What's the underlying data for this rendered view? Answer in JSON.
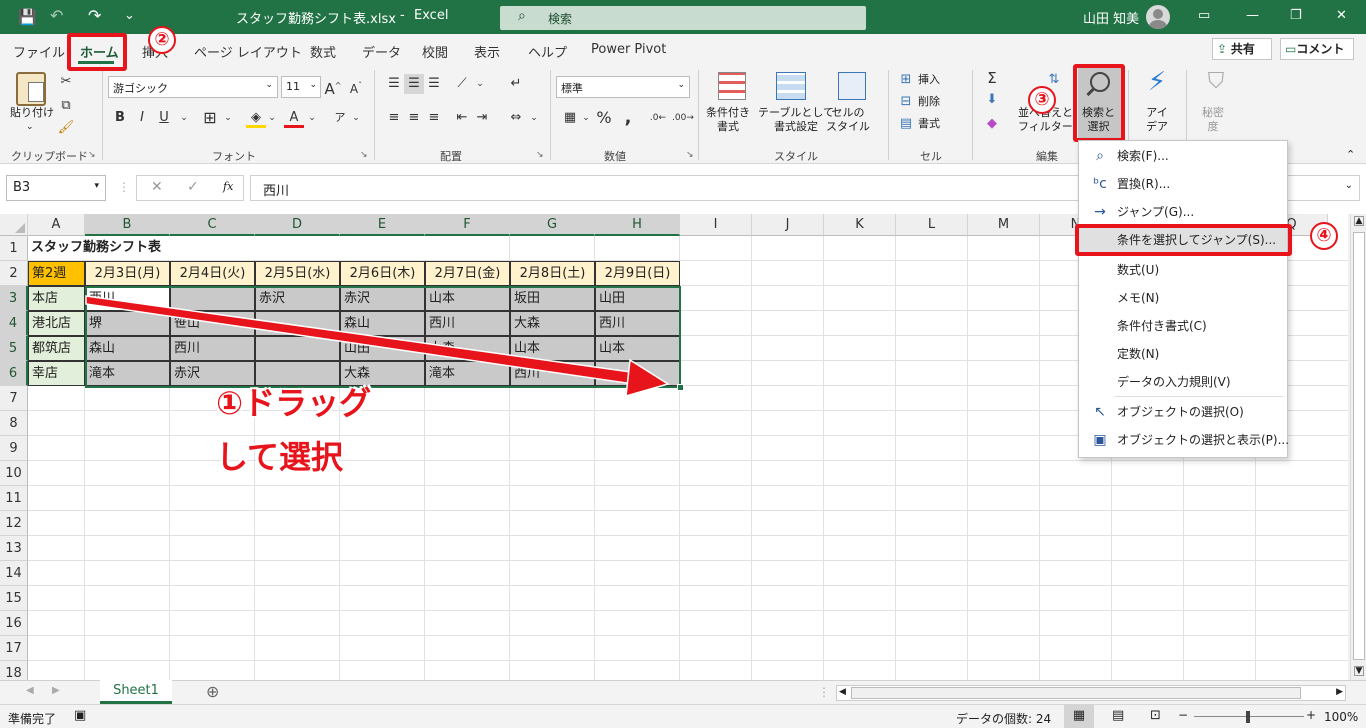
{
  "title": {
    "qat": [
      "💾",
      "↶",
      "↷",
      "⌄"
    ],
    "filename": "スタッフ勤務シフト表.xlsx",
    "separator": "-",
    "app": "Excel",
    "search_placeholder": "検索",
    "user": "山田 知美",
    "win_btns": [
      "▭",
      "—",
      "❐",
      "✕"
    ]
  },
  "menu": {
    "tabs": [
      "ファイル",
      "ホーム",
      "挿入",
      "ページ レイアウト",
      "数式",
      "データ",
      "校閲",
      "表示",
      "ヘルプ",
      "Power Pivot"
    ],
    "share": "共有",
    "comment": "コメント"
  },
  "ribbon": {
    "clipboard": {
      "paste": "貼り付け",
      "group": "クリップボード"
    },
    "font": {
      "name": "游ゴシック",
      "size": "11",
      "bold": "B",
      "italic": "I",
      "underline": "U",
      "group": "フォント"
    },
    "align": {
      "group": "配置"
    },
    "number": {
      "format": "標準",
      "group": "数値"
    },
    "style": {
      "cond": "条件付き\n書式",
      "table": "テーブルとして\n書式設定",
      "cell": "セルの\nスタイル",
      "group": "スタイル"
    },
    "cells": {
      "insert": "挿入",
      "delete": "削除",
      "format": "書式",
      "group": "セル"
    },
    "edit": {
      "sort": "並べ替えと\nフィルター",
      "find": "検索と\n選択",
      "group": "編集"
    },
    "ideas": {
      "label": "アイ\nデア"
    },
    "sens": {
      "label": "秘密\n度"
    }
  },
  "formula_bar": {
    "namebox": "B3",
    "fx": "fx",
    "value": "西川"
  },
  "sheet": {
    "columns": [
      "A",
      "B",
      "C",
      "D",
      "E",
      "F",
      "G",
      "H",
      "I",
      "J",
      "K",
      "L",
      "M",
      "N",
      "O",
      "P",
      "Q"
    ],
    "rows": [
      "1",
      "2",
      "3",
      "4",
      "5",
      "6",
      "7",
      "8",
      "9",
      "10",
      "11",
      "12",
      "13",
      "14",
      "15",
      "16",
      "17",
      "18"
    ],
    "title": "スタッフ勤務シフト表",
    "week": "第2週",
    "dates": [
      "2月3日(月)",
      "2月4日(火)",
      "2月5日(水)",
      "2月6日(木)",
      "2月7日(金)",
      "2月8日(土)",
      "2月9日(日)"
    ],
    "data": [
      [
        "本店",
        "西川",
        "",
        "赤沢",
        "赤沢",
        "山本",
        "坂田",
        "山田"
      ],
      [
        "港北店",
        "堺",
        "笹山",
        "",
        "森山",
        "西川",
        "大森",
        "西川"
      ],
      [
        "都筑店",
        "森山",
        "西川",
        "",
        "山田",
        "大森",
        "山本",
        "山本"
      ],
      [
        "幸店",
        "滝本",
        "赤沢",
        "",
        "大森",
        "滝本",
        "西川",
        ""
      ]
    ]
  },
  "dropdown": [
    {
      "icon": "⌕",
      "label": "検索(F)..."
    },
    {
      "icon": "ᵇc",
      "label": "置換(R)..."
    },
    {
      "icon": "→",
      "label": "ジャンプ(G)..."
    },
    {
      "icon": "",
      "label": "条件を選択してジャンプ(S)..."
    },
    {
      "icon": "",
      "label": "数式(U)"
    },
    {
      "icon": "",
      "label": "メモ(N)"
    },
    {
      "icon": "",
      "label": "条件付き書式(C)"
    },
    {
      "icon": "",
      "label": "定数(N)"
    },
    {
      "icon": "",
      "label": "データの入力規則(V)"
    },
    {
      "icon": "↖",
      "label": "オブジェクトの選択(O)"
    },
    {
      "icon": "▣",
      "label": "オブジェクトの選択と表示(P)..."
    }
  ],
  "annotations": {
    "b1": "①",
    "b2": "②",
    "b3": "③",
    "b4": "④",
    "line1": "①ドラッグ",
    "line2": "して選択",
    "color": "#e8141b"
  },
  "sheet_tab": "Sheet1",
  "status": {
    "ready": "準備完了",
    "count": "データの個数: 24",
    "zoom": "100%",
    "minus": "−",
    "plus": "+"
  }
}
